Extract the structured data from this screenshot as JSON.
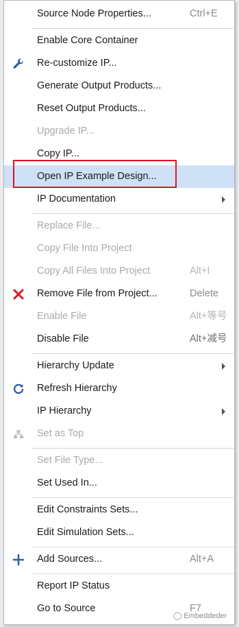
{
  "menu": {
    "items": [
      {
        "label": "Source Node Properties...",
        "shortcut": "Ctrl+E"
      },
      {
        "label": "Enable Core Container",
        "shortcut": ""
      },
      {
        "label": "Re-customize IP...",
        "shortcut": "",
        "icon": "wrench-icon"
      },
      {
        "label": "Generate Output Products...",
        "shortcut": ""
      },
      {
        "label": "Reset Output Products...",
        "shortcut": ""
      },
      {
        "label": "Upgrade IP...",
        "shortcut": ""
      },
      {
        "label": "Copy IP...",
        "shortcut": ""
      },
      {
        "label": "Open IP Example Design...",
        "shortcut": ""
      },
      {
        "label": "IP Documentation",
        "shortcut": ""
      },
      {
        "label": "Replace File...",
        "shortcut": ""
      },
      {
        "label": "Copy File Into Project",
        "shortcut": ""
      },
      {
        "label": "Copy All Files Into Project",
        "shortcut": "Alt+I"
      },
      {
        "label": "Remove File from Project...",
        "shortcut": "Delete",
        "icon": "red-x-icon"
      },
      {
        "label": "Enable File",
        "shortcut": "Alt+等号"
      },
      {
        "label": "Disable File",
        "shortcut": "Alt+减号"
      },
      {
        "label": "Hierarchy Update",
        "shortcut": ""
      },
      {
        "label": "Refresh Hierarchy",
        "shortcut": "",
        "icon": "refresh-icon"
      },
      {
        "label": "IP Hierarchy",
        "shortcut": ""
      },
      {
        "label": "Set as Top",
        "shortcut": "",
        "icon": "hierarchy-icon"
      },
      {
        "label": "Set File Type...",
        "shortcut": ""
      },
      {
        "label": "Set Used In...",
        "shortcut": ""
      },
      {
        "label": "Edit Constraints Sets...",
        "shortcut": ""
      },
      {
        "label": "Edit Simulation Sets...",
        "shortcut": ""
      },
      {
        "label": "Add Sources...",
        "shortcut": "Alt+A",
        "icon": "plus-icon"
      },
      {
        "label": "Report IP Status",
        "shortcut": ""
      },
      {
        "label": "Go to Source",
        "shortcut": "F7"
      }
    ]
  },
  "colors": {
    "highlight_bg": "#cfe1f6",
    "annotation_box": "#e0141e",
    "disabled_text": "#a9a9a9",
    "icon_blue": "#2f5fa8",
    "icon_red": "#e0141e"
  },
  "watermark": {
    "icon": "wechat-icon",
    "text": "Embeddeder"
  }
}
